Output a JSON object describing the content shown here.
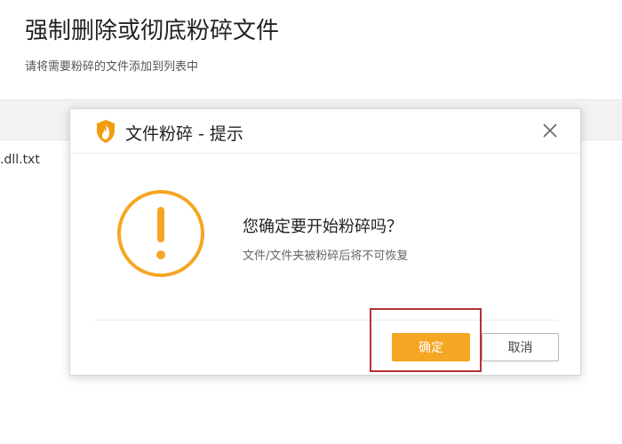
{
  "page": {
    "title": "强制删除或彻底粉碎文件",
    "subtitle": "请将需要粉碎的文件添加到列表中",
    "file_item": ".dll.txt"
  },
  "dialog": {
    "title": "文件粉碎 - 提示",
    "question": "您确定要开始粉碎吗？",
    "hint": "文件/文件夹被粉碎后将不可恢复",
    "ok_label": "确定",
    "cancel_label": "取消",
    "icons": {
      "logo": "shredder-flame-shield-icon",
      "warning": "exclamation-circle-icon",
      "close": "close-icon"
    }
  },
  "colors": {
    "accent": "#f5a623",
    "highlight": "#b4303a",
    "header_band": "#f2f2f2"
  }
}
